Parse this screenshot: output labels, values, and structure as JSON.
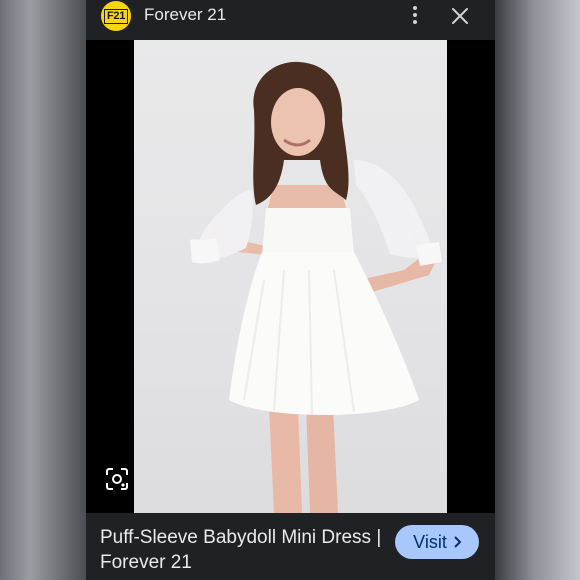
{
  "header": {
    "logo_text": "F21",
    "site_name": "Forever 21",
    "more_icon": "more-vert-icon",
    "close_icon": "close-icon"
  },
  "viewer": {
    "lens_icon": "google-lens-icon"
  },
  "caption": {
    "title": "Puff-Sleeve Babydoll Mini Dress | Forever 21",
    "visit_label": "Visit",
    "visit_icon": "chevron-right-icon"
  },
  "colors": {
    "logo_bg": "#f7d414",
    "bar_bg": "#202124",
    "visit_bg": "#a8c7fa",
    "text": "#e8eaed"
  }
}
